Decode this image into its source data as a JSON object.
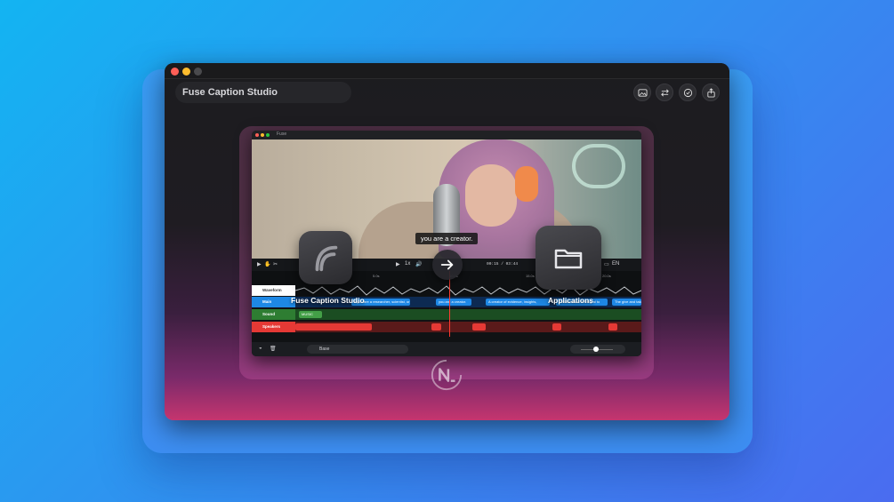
{
  "window": {
    "title": "Fuse Caption Studio",
    "toolbar_icons": [
      "image-icon",
      "swap-arrows-icon",
      "checkmark-circle-icon",
      "export-icon"
    ]
  },
  "inner_app": {
    "title": "Fuse",
    "caption_text": "you are a creator.",
    "timecode": "00:15 / 03:44",
    "language": "EN",
    "speed": "1x",
    "ruler_ticks": [
      "5.0s",
      "10.0s",
      "15.0s",
      "20.0s"
    ],
    "tracks": [
      {
        "name": "Waveform",
        "color": "#ffffff",
        "text_color": "#333333"
      },
      {
        "name": "Main",
        "color": "#1e88e5",
        "clips": [
          "If you are a researcher, scientist, or",
          "you are a creator.",
          "A creator of evidence, insights,",
          "Collaboration is integral to",
          "The give and take"
        ]
      },
      {
        "name": "Sound",
        "color": "#2e7d32",
        "clips": [
          "MUSIC"
        ]
      },
      {
        "name": "Speakers",
        "color": "#e53935"
      }
    ],
    "preset": "Base"
  },
  "overlay": {
    "source_app_label": "Fuse Caption Studio",
    "destination_label": "Applications",
    "source_icon": "fuse-app-icon",
    "destination_icon": "folder-icon",
    "arrow_icon": "arrow-right-icon"
  },
  "brand": {
    "logo": "n-logo-icon",
    "accent": "#e8356f"
  }
}
